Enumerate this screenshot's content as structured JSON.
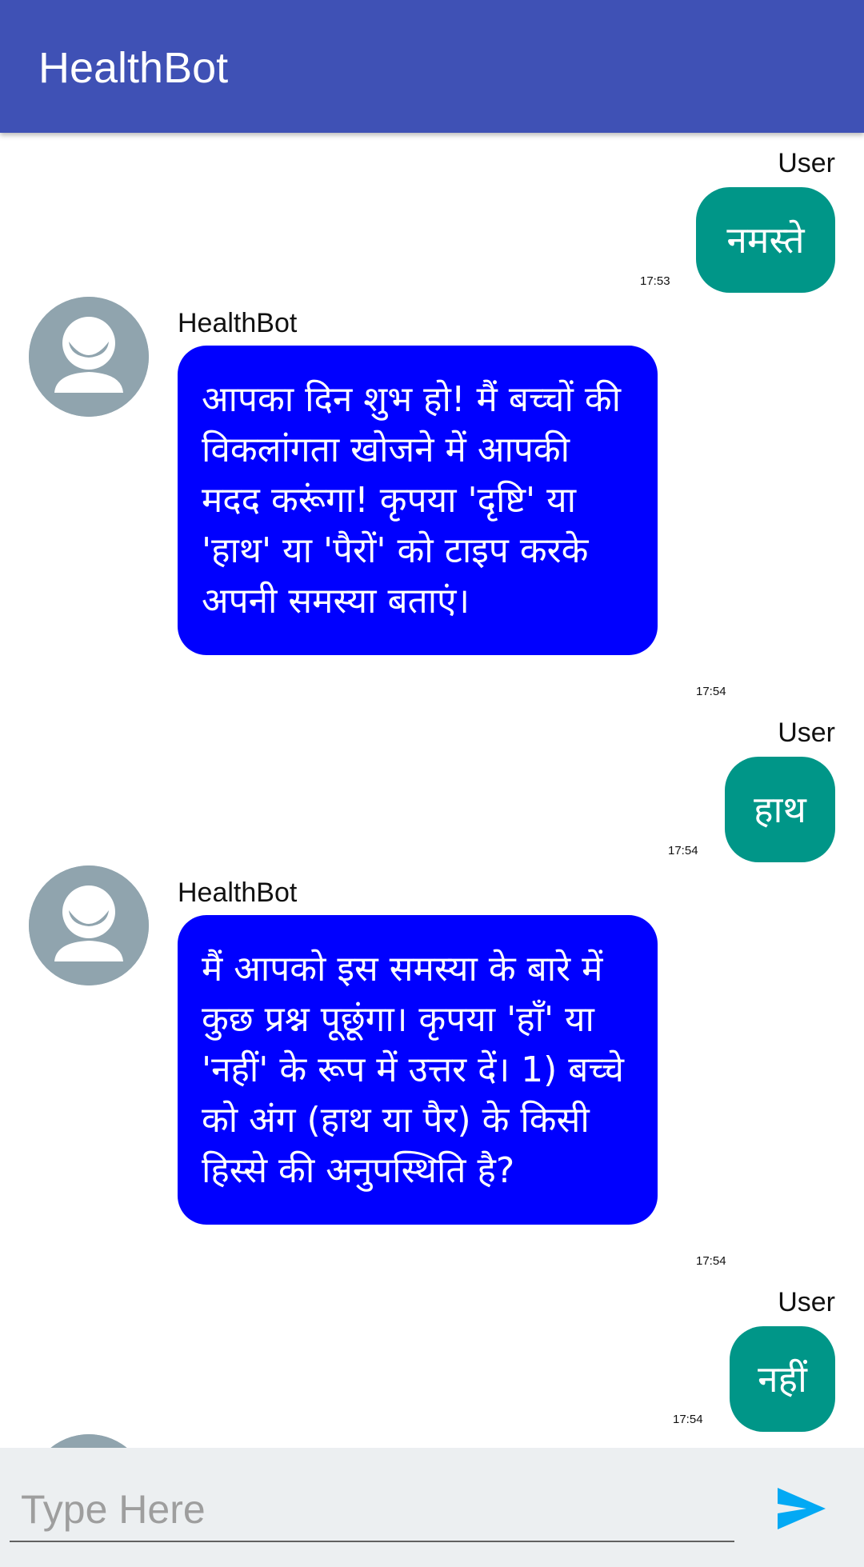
{
  "app": {
    "title": "HealthBot"
  },
  "colors": {
    "appbar": "#3f51b5",
    "user_bubble": "#009688",
    "bot_bubble": "#0000ff",
    "avatar": "#90a4ae",
    "send_icon": "#03a9f4",
    "input_bar": "#eceff1"
  },
  "messages": [
    {
      "sender": "User",
      "text": "नमस्ते",
      "time": "17:53"
    },
    {
      "sender": "HealthBot",
      "text": "आपका दिन शुभ हो! मैं बच्चों की विकलांगता खोजने में आपकी मदद करूंगा! कृपया 'दृष्टि' या 'हाथ' या 'पैरों' को टाइप करके अपनी समस्या बताएं।",
      "time": "17:54"
    },
    {
      "sender": "User",
      "text": "हाथ",
      "time": "17:54"
    },
    {
      "sender": "HealthBot",
      "text": "मैं आपको इस समस्या के बारे में कुछ प्रश्न पूछूंगा। कृपया 'हाँ' या 'नहीं' के रूप में उत्तर दें। 1) बच्चे को अंग (हाथ या पैर) के किसी हिस्से की अनुपस्थिति है?",
      "time": "17:54"
    },
    {
      "sender": "User",
      "text": "नहीं",
      "time": "17:54"
    }
  ],
  "input": {
    "placeholder": "Type Here",
    "value": ""
  },
  "icons": {
    "avatar": "person-icon",
    "send": "send-icon"
  }
}
